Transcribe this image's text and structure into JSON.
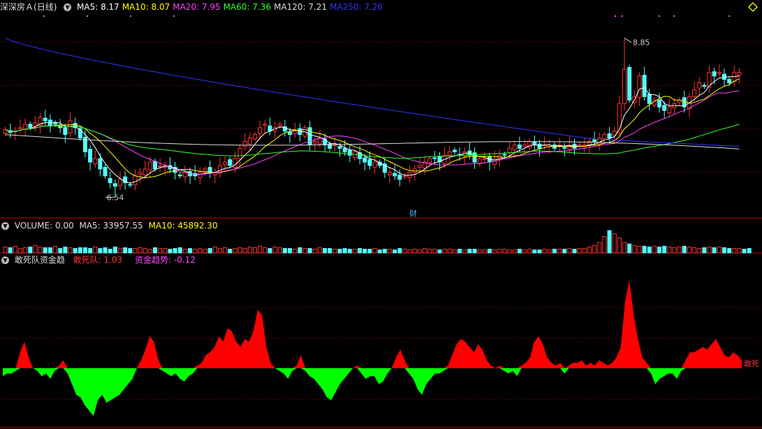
{
  "header": {
    "stock_name": "深深房Ａ",
    "period": "(日线)",
    "ma": [
      {
        "label": "MA5: ",
        "value": "8.17",
        "color": "#ffffff"
      },
      {
        "label": "MA10: ",
        "value": "8.07",
        "color": "#ffff00"
      },
      {
        "label": "MA20: ",
        "value": "7.95",
        "color": "#ff44ff"
      },
      {
        "label": "MA60: ",
        "value": "7.36",
        "color": "#33ff33"
      },
      {
        "label": "MA120: ",
        "value": "7.21",
        "color": "#dddddd"
      },
      {
        "label": "MA250: ",
        "value": "7.26",
        "color": "#3333ff"
      }
    ]
  },
  "volume_header": {
    "label": "VOLUME: ",
    "value": "0.00",
    "ma5_label": "MA5: ",
    "ma5_value": "33957.55",
    "ma10_label": "MA10: ",
    "ma10_value": "45892.30"
  },
  "indicator_header": {
    "name": "敢死队资金趋",
    "s1_label": "敢死队: ",
    "s1_value": "1.03",
    "s2_label": "资金趋势: ",
    "s2_value": "-0.12"
  },
  "annotations": {
    "high": "8.85",
    "low": "6.54",
    "event": "财",
    "right_tag": "敢死"
  },
  "colors": {
    "up": "#ff3232",
    "down": "#54ffff",
    "pos_area": "#ff0000",
    "neg_area": "#00ff00",
    "grid": "#7a1010",
    "divider": "#c00000"
  },
  "chart_data": [
    {
      "type": "candlestick",
      "title": "深深房Ａ (日线)",
      "annotations": [
        "8.85",
        "6.54"
      ],
      "high_value": 8.85,
      "low_value": 6.54,
      "ylim": [
        6.3,
        9.2
      ],
      "ma_latest": {
        "MA5": 8.17,
        "MA10": 8.07,
        "MA20": 7.95,
        "MA60": 7.36,
        "MA120": 7.21,
        "MA250": 7.26
      },
      "closes": [
        7.52,
        7.48,
        7.5,
        7.55,
        7.6,
        7.55,
        7.62,
        7.7,
        7.65,
        7.58,
        7.6,
        7.55,
        7.45,
        7.65,
        7.55,
        7.4,
        7.2,
        7.05,
        7.1,
        6.95,
        6.85,
        6.75,
        6.7,
        6.8,
        6.75,
        6.72,
        6.85,
        6.9,
        6.95,
        7.05,
        6.95,
        7.0,
        7.0,
        6.95,
        6.9,
        6.85,
        6.9,
        6.85,
        6.85,
        6.9,
        6.95,
        6.9,
        6.9,
        7.0,
        7.05,
        7.0,
        7.1,
        7.25,
        7.35,
        7.4,
        7.45,
        7.55,
        7.6,
        7.5,
        7.55,
        7.6,
        7.5,
        7.45,
        7.5,
        7.45,
        7.55,
        7.3,
        7.35,
        7.4,
        7.3,
        7.25,
        7.3,
        7.25,
        7.2,
        7.15,
        7.2,
        7.1,
        7.05,
        7.0,
        7.05,
        7.0,
        6.9,
        6.9,
        6.85,
        6.8,
        6.85,
        6.9,
        6.95,
        7.0,
        7.05,
        7.1,
        7.1,
        7.05,
        7.15,
        7.2,
        7.2,
        7.15,
        7.2,
        7.15,
        7.05,
        7.1,
        7.1,
        7.05,
        7.1,
        7.15,
        7.15,
        7.25,
        7.3,
        7.25,
        7.3,
        7.35,
        7.3,
        7.25,
        7.3,
        7.3,
        7.25,
        7.3,
        7.25,
        7.3,
        7.25,
        7.3,
        7.3,
        7.35,
        7.35,
        7.4,
        7.45,
        7.4,
        7.5,
        7.9,
        8.4,
        7.95,
        8.0,
        8.3,
        8.0,
        7.9,
        7.95,
        7.85,
        7.8,
        7.85,
        7.9,
        7.95,
        7.85,
        8.0,
        8.1,
        8.2,
        8.15,
        8.35,
        8.3,
        8.35,
        8.25,
        8.2,
        8.35,
        8.35
      ]
    },
    {
      "type": "bar",
      "title": "VOLUME",
      "values": [
        8,
        7,
        9,
        6,
        7,
        8,
        10,
        8,
        7,
        7,
        9,
        6,
        8,
        7,
        6,
        7,
        7,
        6,
        8,
        6,
        7,
        5,
        8,
        6,
        7,
        6,
        6,
        7,
        6,
        5,
        7,
        6,
        6,
        5,
        6,
        7,
        5,
        6,
        5,
        6,
        5,
        6,
        8,
        6,
        7,
        5,
        6,
        7,
        6,
        8,
        7,
        9,
        7,
        6,
        8,
        7,
        6,
        6,
        5,
        7,
        6,
        6,
        5,
        7,
        6,
        6,
        5,
        5,
        6,
        5,
        5,
        6,
        5,
        5,
        6,
        4,
        5,
        5,
        4,
        6,
        5,
        4,
        5,
        4,
        6,
        5,
        5,
        4,
        5,
        5,
        4,
        5,
        4,
        5,
        5,
        4,
        4,
        5,
        4,
        5,
        5,
        4,
        4,
        5,
        4,
        5,
        4,
        4,
        5,
        4,
        5,
        5,
        5,
        6,
        5,
        6,
        6,
        8,
        10,
        14,
        22,
        30,
        26,
        20,
        14,
        12,
        10,
        9,
        9,
        8,
        9,
        8,
        9,
        8,
        7,
        8,
        9,
        8,
        7,
        6,
        7,
        8,
        7,
        8,
        7,
        6,
        6,
        6,
        5,
        6
      ]
    },
    {
      "type": "area",
      "title": "敢死队资金趋",
      "series": [
        {
          "name": "敢死队",
          "values": [
            -3,
            -2,
            -2,
            -1,
            6,
            10,
            4,
            0,
            -1,
            -3,
            -2,
            -4,
            -1,
            1,
            3,
            -2,
            -6,
            -10,
            -11,
            -14,
            -16,
            -18,
            -12,
            -10,
            -13,
            -12,
            -11,
            -10,
            -8,
            -6,
            -4,
            0,
            3,
            7,
            12,
            10,
            3,
            -1,
            -2,
            -3,
            -2,
            -4,
            -5,
            -3,
            -2,
            1,
            2,
            5,
            6,
            8,
            12,
            10,
            15,
            14,
            10,
            8,
            11,
            10,
            14,
            22,
            20,
            8,
            2,
            0,
            -1,
            -2,
            -4,
            -1,
            1,
            5,
            -1,
            -3,
            -4,
            -6,
            -8,
            -11,
            -12,
            -9,
            -6,
            -4,
            -2,
            0,
            1,
            -2,
            -4,
            -3,
            -3,
            -6,
            -5,
            -2,
            0,
            4,
            7,
            3,
            -2,
            -4,
            -8,
            -10,
            -6,
            -4,
            -2,
            -2,
            -1,
            1,
            5,
            9,
            11,
            10,
            8,
            6,
            9,
            7,
            3,
            1,
            0,
            1,
            -1,
            -2,
            -1,
            -3,
            1,
            2,
            4,
            10,
            12,
            9,
            4,
            2,
            1,
            2,
            -2,
            1,
            2,
            2,
            3,
            1,
            2,
            1,
            3,
            2,
            1,
            2,
            4,
            8,
            25,
            33,
            20,
            11,
            4,
            2,
            -2,
            -6,
            -4,
            -3,
            -2,
            -2,
            -4,
            -1,
            3,
            6,
            6,
            7,
            8,
            7,
            9,
            11,
            8,
            5,
            4,
            6,
            5,
            3
          ]
        }
      ],
      "s1_latest": 1.03,
      "s2_latest": -0.12
    }
  ]
}
